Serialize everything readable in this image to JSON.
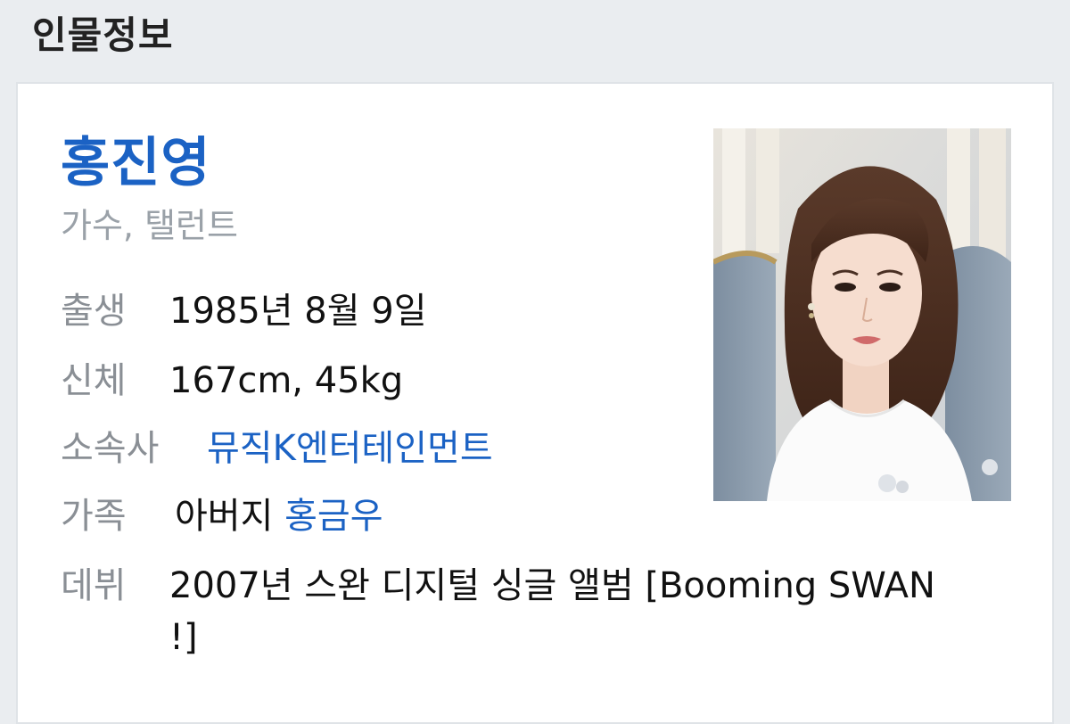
{
  "header": {
    "title": "인물정보"
  },
  "person": {
    "name": "홍진영",
    "occupation": "가수, 탤런트",
    "photo_icon": "person-photo-icon",
    "fields": {
      "birth": {
        "label": "출생",
        "value": "1985년 8월 9일"
      },
      "body": {
        "label": "신체",
        "value": "167cm, 45kg"
      },
      "agency": {
        "label": "소속사",
        "value": "뮤직K엔터테인먼트"
      },
      "family": {
        "label": "가족",
        "relation": "아버지",
        "name": "홍금우"
      },
      "debut": {
        "label": "데뷔",
        "value": "2007년 스완 디지털 싱글 앨범 [Booming SWAN !]"
      }
    }
  },
  "colors": {
    "link": "#1b62c4",
    "label": "#8a8f95",
    "occupation": "#9aa1a8",
    "background": "#eaedf0",
    "card": "#ffffff"
  }
}
